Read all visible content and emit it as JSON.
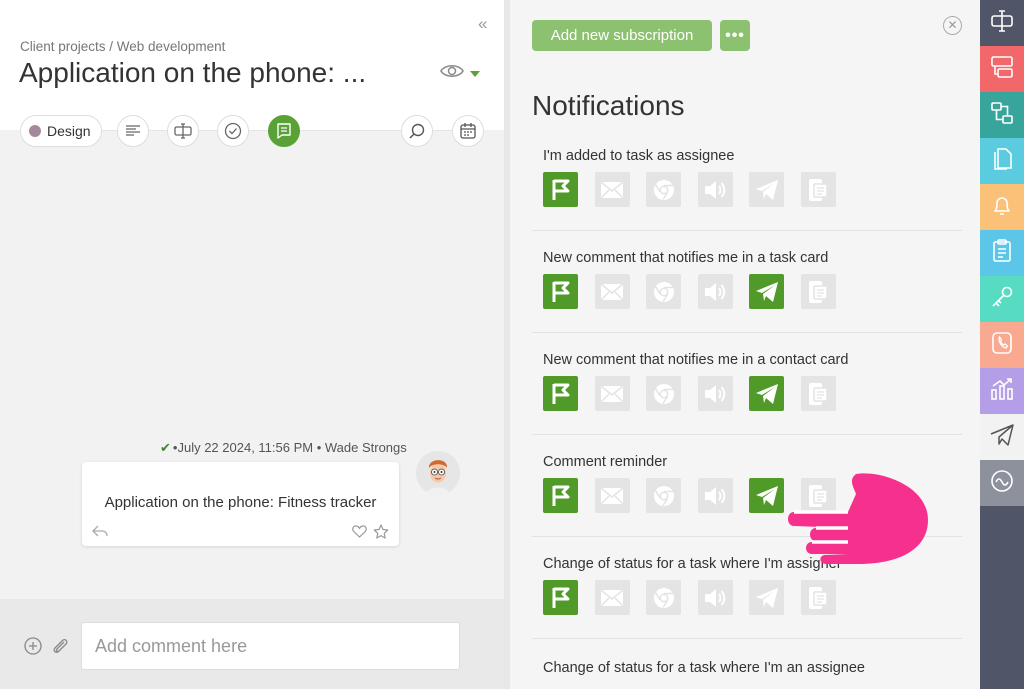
{
  "task": {
    "breadcrumb": "Client projects / Web development",
    "title": "Application on the  phone: ...",
    "tag_label": "Design"
  },
  "message": {
    "date": "July 22 2024, 11:56 PM",
    "author": "Wade Strongs",
    "text": "Application on the phone: Fitness tracker"
  },
  "comment": {
    "placeholder": "Add comment here"
  },
  "subscriptions": {
    "add_button": "Add new subscription",
    "more_button": "•••",
    "title": "Notifications",
    "channels": [
      "flag-icon",
      "mail-icon",
      "browser-icon",
      "sound-icon",
      "telegram-icon",
      "mobile-icon"
    ],
    "rows": [
      {
        "label": "I'm added to task as assignee",
        "active": [
          true,
          false,
          false,
          false,
          false,
          false
        ]
      },
      {
        "label": "New comment that notifies me in a task card",
        "active": [
          true,
          false,
          false,
          false,
          true,
          false
        ]
      },
      {
        "label": "New comment that notifies me in a contact card",
        "active": [
          true,
          false,
          false,
          false,
          true,
          false
        ]
      },
      {
        "label": "Comment reminder",
        "active": [
          true,
          false,
          false,
          false,
          true,
          false
        ]
      },
      {
        "label": "Change of status for a task where I'm assigner",
        "active": [
          true,
          false,
          false,
          false,
          false,
          false
        ]
      },
      {
        "label": "Change of status for a task where I'm an assignee",
        "active": [
          true,
          false,
          false,
          false,
          false,
          false
        ]
      }
    ]
  },
  "nav": {
    "items": [
      {
        "name": "nav-item-tasks",
        "icon": "text-cursor-icon",
        "color": "#505568"
      },
      {
        "name": "nav-item-boards",
        "icon": "board-icon",
        "color": "#f2686a"
      },
      {
        "name": "nav-item-processes",
        "icon": "process-icon",
        "color": "#38a59c"
      },
      {
        "name": "nav-item-documents",
        "icon": "documents-icon",
        "color": "#5bcbe0"
      },
      {
        "name": "nav-item-notifications",
        "icon": "bell-icon",
        "color": "#fbc179"
      },
      {
        "name": "nav-item-clipboard",
        "icon": "clipboard-icon",
        "color": "#5cc6e8"
      },
      {
        "name": "nav-item-passwords",
        "icon": "key-icon",
        "color": "#57dcc3"
      },
      {
        "name": "nav-item-contacts",
        "icon": "phone-icon",
        "color": "#f8a98f"
      },
      {
        "name": "nav-item-reports",
        "icon": "chart-icon",
        "color": "#b59ee8"
      },
      {
        "name": "nav-item-telegram",
        "icon": "paper-plane-icon",
        "color": "#f2f2f2"
      },
      {
        "name": "nav-item-integrations",
        "icon": "wave-icon",
        "color": "#8d919c"
      }
    ]
  }
}
